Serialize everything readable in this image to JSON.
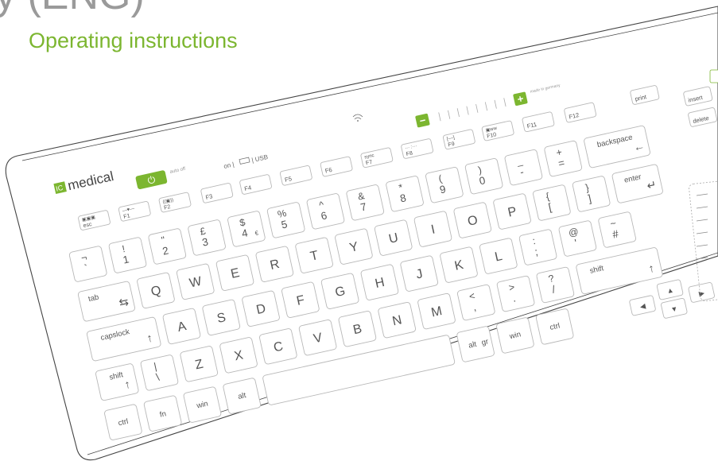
{
  "page": {
    "title_fragment": "y (ENG)",
    "subtitle": "Operating instructions"
  },
  "brand": {
    "logo_mark": "IC",
    "name": "medical"
  },
  "colors": {
    "accent": "#7cb630",
    "text": "#555555",
    "key_border": "#b8b8b8",
    "outline": "#444444"
  },
  "status": {
    "auto_off": "auto off",
    "on": "on |",
    "usb": "| USB",
    "made_in": "made in germany"
  },
  "controls": {
    "minus": "−",
    "plus": "+"
  },
  "fn_row": [
    {
      "id": "esc",
      "main": "esc",
      "green": "▣▣▣"
    },
    {
      "id": "f1",
      "main": "F1",
      "green": "—♥—"
    },
    {
      "id": "f2",
      "main": "F2",
      "green": "((▣))"
    },
    {
      "id": "f3",
      "main": "F3"
    },
    {
      "id": "f4",
      "main": "F4"
    },
    {
      "id": "f5",
      "main": "F5"
    },
    {
      "id": "f6",
      "main": "F6"
    },
    {
      "id": "f7",
      "main": "F7",
      "green": "sync"
    },
    {
      "id": "f8",
      "main": "F8",
      "green": "··· :···"
    },
    {
      "id": "f9",
      "main": "F9",
      "green": "[––]"
    },
    {
      "id": "f10",
      "main": "F10",
      "green": "▣ww"
    },
    {
      "id": "f11",
      "main": "F11"
    },
    {
      "id": "f12",
      "main": "F12"
    },
    {
      "id": "print",
      "main": "print"
    },
    {
      "id": "insert",
      "main": "insert"
    },
    {
      "id": "delete",
      "main": "delete"
    }
  ],
  "rows": {
    "numbers": [
      {
        "id": "grave",
        "top": "¬",
        "bot": "`"
      },
      {
        "id": "1",
        "top": "!",
        "bot": "1"
      },
      {
        "id": "2",
        "top": "\"",
        "bot": "2"
      },
      {
        "id": "3",
        "top": "£",
        "bot": "3"
      },
      {
        "id": "4",
        "top": "$",
        "bot": "4",
        "extra": "€"
      },
      {
        "id": "5",
        "top": "%",
        "bot": "5"
      },
      {
        "id": "6",
        "top": "^",
        "bot": "6"
      },
      {
        "id": "7",
        "top": "&",
        "bot": "7"
      },
      {
        "id": "8",
        "top": "*",
        "bot": "8"
      },
      {
        "id": "9",
        "top": "(",
        "bot": "9"
      },
      {
        "id": "0",
        "top": ")",
        "bot": "0"
      },
      {
        "id": "minus",
        "top": "_",
        "bot": "-"
      },
      {
        "id": "equal",
        "top": "+",
        "bot": "="
      },
      {
        "id": "backspace",
        "main": "backspace",
        "arrow": "←"
      }
    ],
    "qwerty": [
      {
        "id": "tab",
        "main": "tab",
        "arrow": "⇆"
      },
      {
        "id": "q",
        "main": "Q"
      },
      {
        "id": "w",
        "main": "W"
      },
      {
        "id": "e",
        "main": "E"
      },
      {
        "id": "r",
        "main": "R"
      },
      {
        "id": "t",
        "main": "T"
      },
      {
        "id": "y",
        "main": "Y"
      },
      {
        "id": "u",
        "main": "U"
      },
      {
        "id": "i",
        "main": "I"
      },
      {
        "id": "o",
        "main": "O"
      },
      {
        "id": "p",
        "main": "P"
      },
      {
        "id": "lbrace",
        "top": "{",
        "bot": "["
      },
      {
        "id": "rbrace",
        "top": "}",
        "bot": "]"
      },
      {
        "id": "enter",
        "main": "enter",
        "arrow": "↵"
      }
    ],
    "home": [
      {
        "id": "capslock",
        "main": "capslock",
        "arrow": "↑"
      },
      {
        "id": "a",
        "main": "A"
      },
      {
        "id": "s",
        "main": "S"
      },
      {
        "id": "d",
        "main": "D"
      },
      {
        "id": "f",
        "main": "F"
      },
      {
        "id": "g",
        "main": "G"
      },
      {
        "id": "h",
        "main": "H"
      },
      {
        "id": "j",
        "main": "J"
      },
      {
        "id": "k",
        "main": "K"
      },
      {
        "id": "l",
        "main": "L"
      },
      {
        "id": "semicolon",
        "top": ":",
        "bot": ";"
      },
      {
        "id": "quote",
        "top": "@",
        "bot": "'"
      },
      {
        "id": "hash",
        "top": "~",
        "bot": "#"
      }
    ],
    "shift_row": [
      {
        "id": "lshift",
        "main": "shift",
        "arrow": "↑"
      },
      {
        "id": "backslash",
        "top": "|",
        "bot": "\\"
      },
      {
        "id": "z",
        "main": "Z"
      },
      {
        "id": "x",
        "main": "X"
      },
      {
        "id": "c",
        "main": "C"
      },
      {
        "id": "v",
        "main": "V"
      },
      {
        "id": "b",
        "main": "B"
      },
      {
        "id": "n",
        "main": "N"
      },
      {
        "id": "m",
        "main": "M"
      },
      {
        "id": "comma",
        "top": "<",
        "bot": ","
      },
      {
        "id": "period",
        "top": ">",
        "bot": "."
      },
      {
        "id": "slash",
        "top": "?",
        "bot": "/"
      },
      {
        "id": "rshift",
        "main": "shift",
        "arrow": "↑"
      }
    ],
    "bottom": [
      {
        "id": "lctrl",
        "main": "ctrl"
      },
      {
        "id": "fn",
        "main": "fn",
        "green": true
      },
      {
        "id": "lwin",
        "main": "win"
      },
      {
        "id": "alt",
        "main": "alt"
      },
      {
        "id": "space",
        "main": ""
      },
      {
        "id": "altgr",
        "main": "alt",
        "suffix": "gr"
      },
      {
        "id": "rwin",
        "main": "win"
      },
      {
        "id": "rctrl",
        "main": "ctrl"
      }
    ],
    "arrows": [
      {
        "id": "left",
        "main": "◀"
      },
      {
        "id": "up",
        "main": "▲"
      },
      {
        "id": "down",
        "main": "▼"
      },
      {
        "id": "right",
        "main": "▶"
      }
    ]
  }
}
